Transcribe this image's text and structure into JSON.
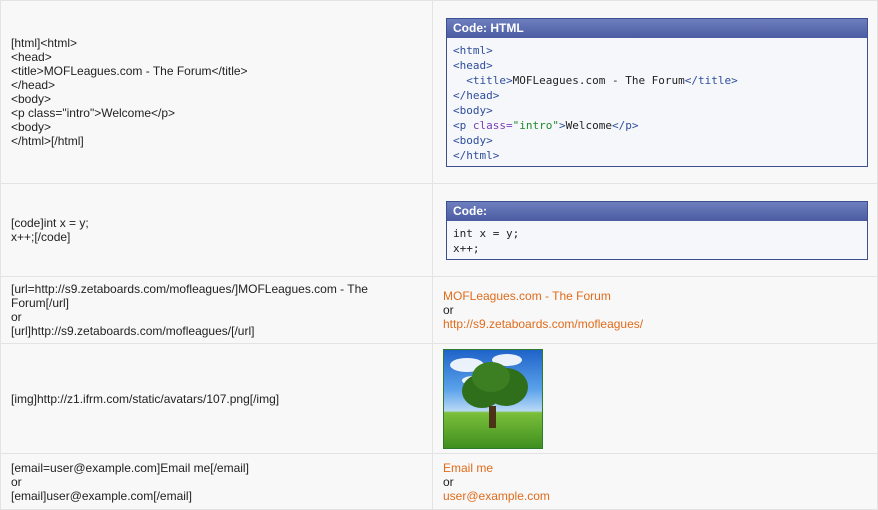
{
  "rows": [
    {
      "source_lines": [
        "[html]<html>",
        "<head>",
        "<title>MOFLeagues.com - The Forum</title>",
        "</head>",
        "<body>",
        "<p class=\"intro\">Welcome</p>",
        "<body>",
        "</html>[/html]"
      ],
      "box_title": "Code: HTML"
    },
    {
      "source_lines": [
        "[code]int x = y;",
        "x++;[/code]"
      ],
      "box_title": "Code:",
      "code_lines": [
        "int x = y;",
        "x++;"
      ]
    },
    {
      "source_lines": [
        "[url=http://s9.zetaboards.com/mofleagues/]MOFLeagues.com - The",
        "Forum[/url]",
        "or",
        "[url]http://s9.zetaboards.com/mofleagues/[/url]"
      ],
      "link1": "MOFLeagues.com - The Forum",
      "or": "or",
      "link2": "http://s9.zetaboards.com/mofleagues/"
    },
    {
      "source_lines": [
        "[img]http://z1.ifrm.com/static/avatars/107.png[/img]"
      ]
    },
    {
      "source_lines": [
        "[email=user@example.com]Email me[/email]",
        "or",
        "[email]user@example.com[/email]"
      ],
      "link1": "Email me",
      "or": "or",
      "link2": "user@example.com"
    }
  ],
  "html_code": {
    "open_html": "<html>",
    "open_head": "<head>",
    "title_open": "<title>",
    "title_text": "MOFLeagues.com - The Forum",
    "title_close": "</title>",
    "close_head": "</head>",
    "open_body": "<body>",
    "p_open_start": "<p",
    "p_attr": " class=",
    "p_attr_val": "\"intro\"",
    "p_open_end": ">",
    "p_text": "Welcome",
    "p_close": "</p>",
    "body_tag": "<body>",
    "close_html": "</html>"
  },
  "colors": {
    "link": "#e06b1a",
    "box_header": "#4a5ba0",
    "tag": "#2e4e9c",
    "attr": "#7a3fb5",
    "string": "#1f8a2b"
  }
}
